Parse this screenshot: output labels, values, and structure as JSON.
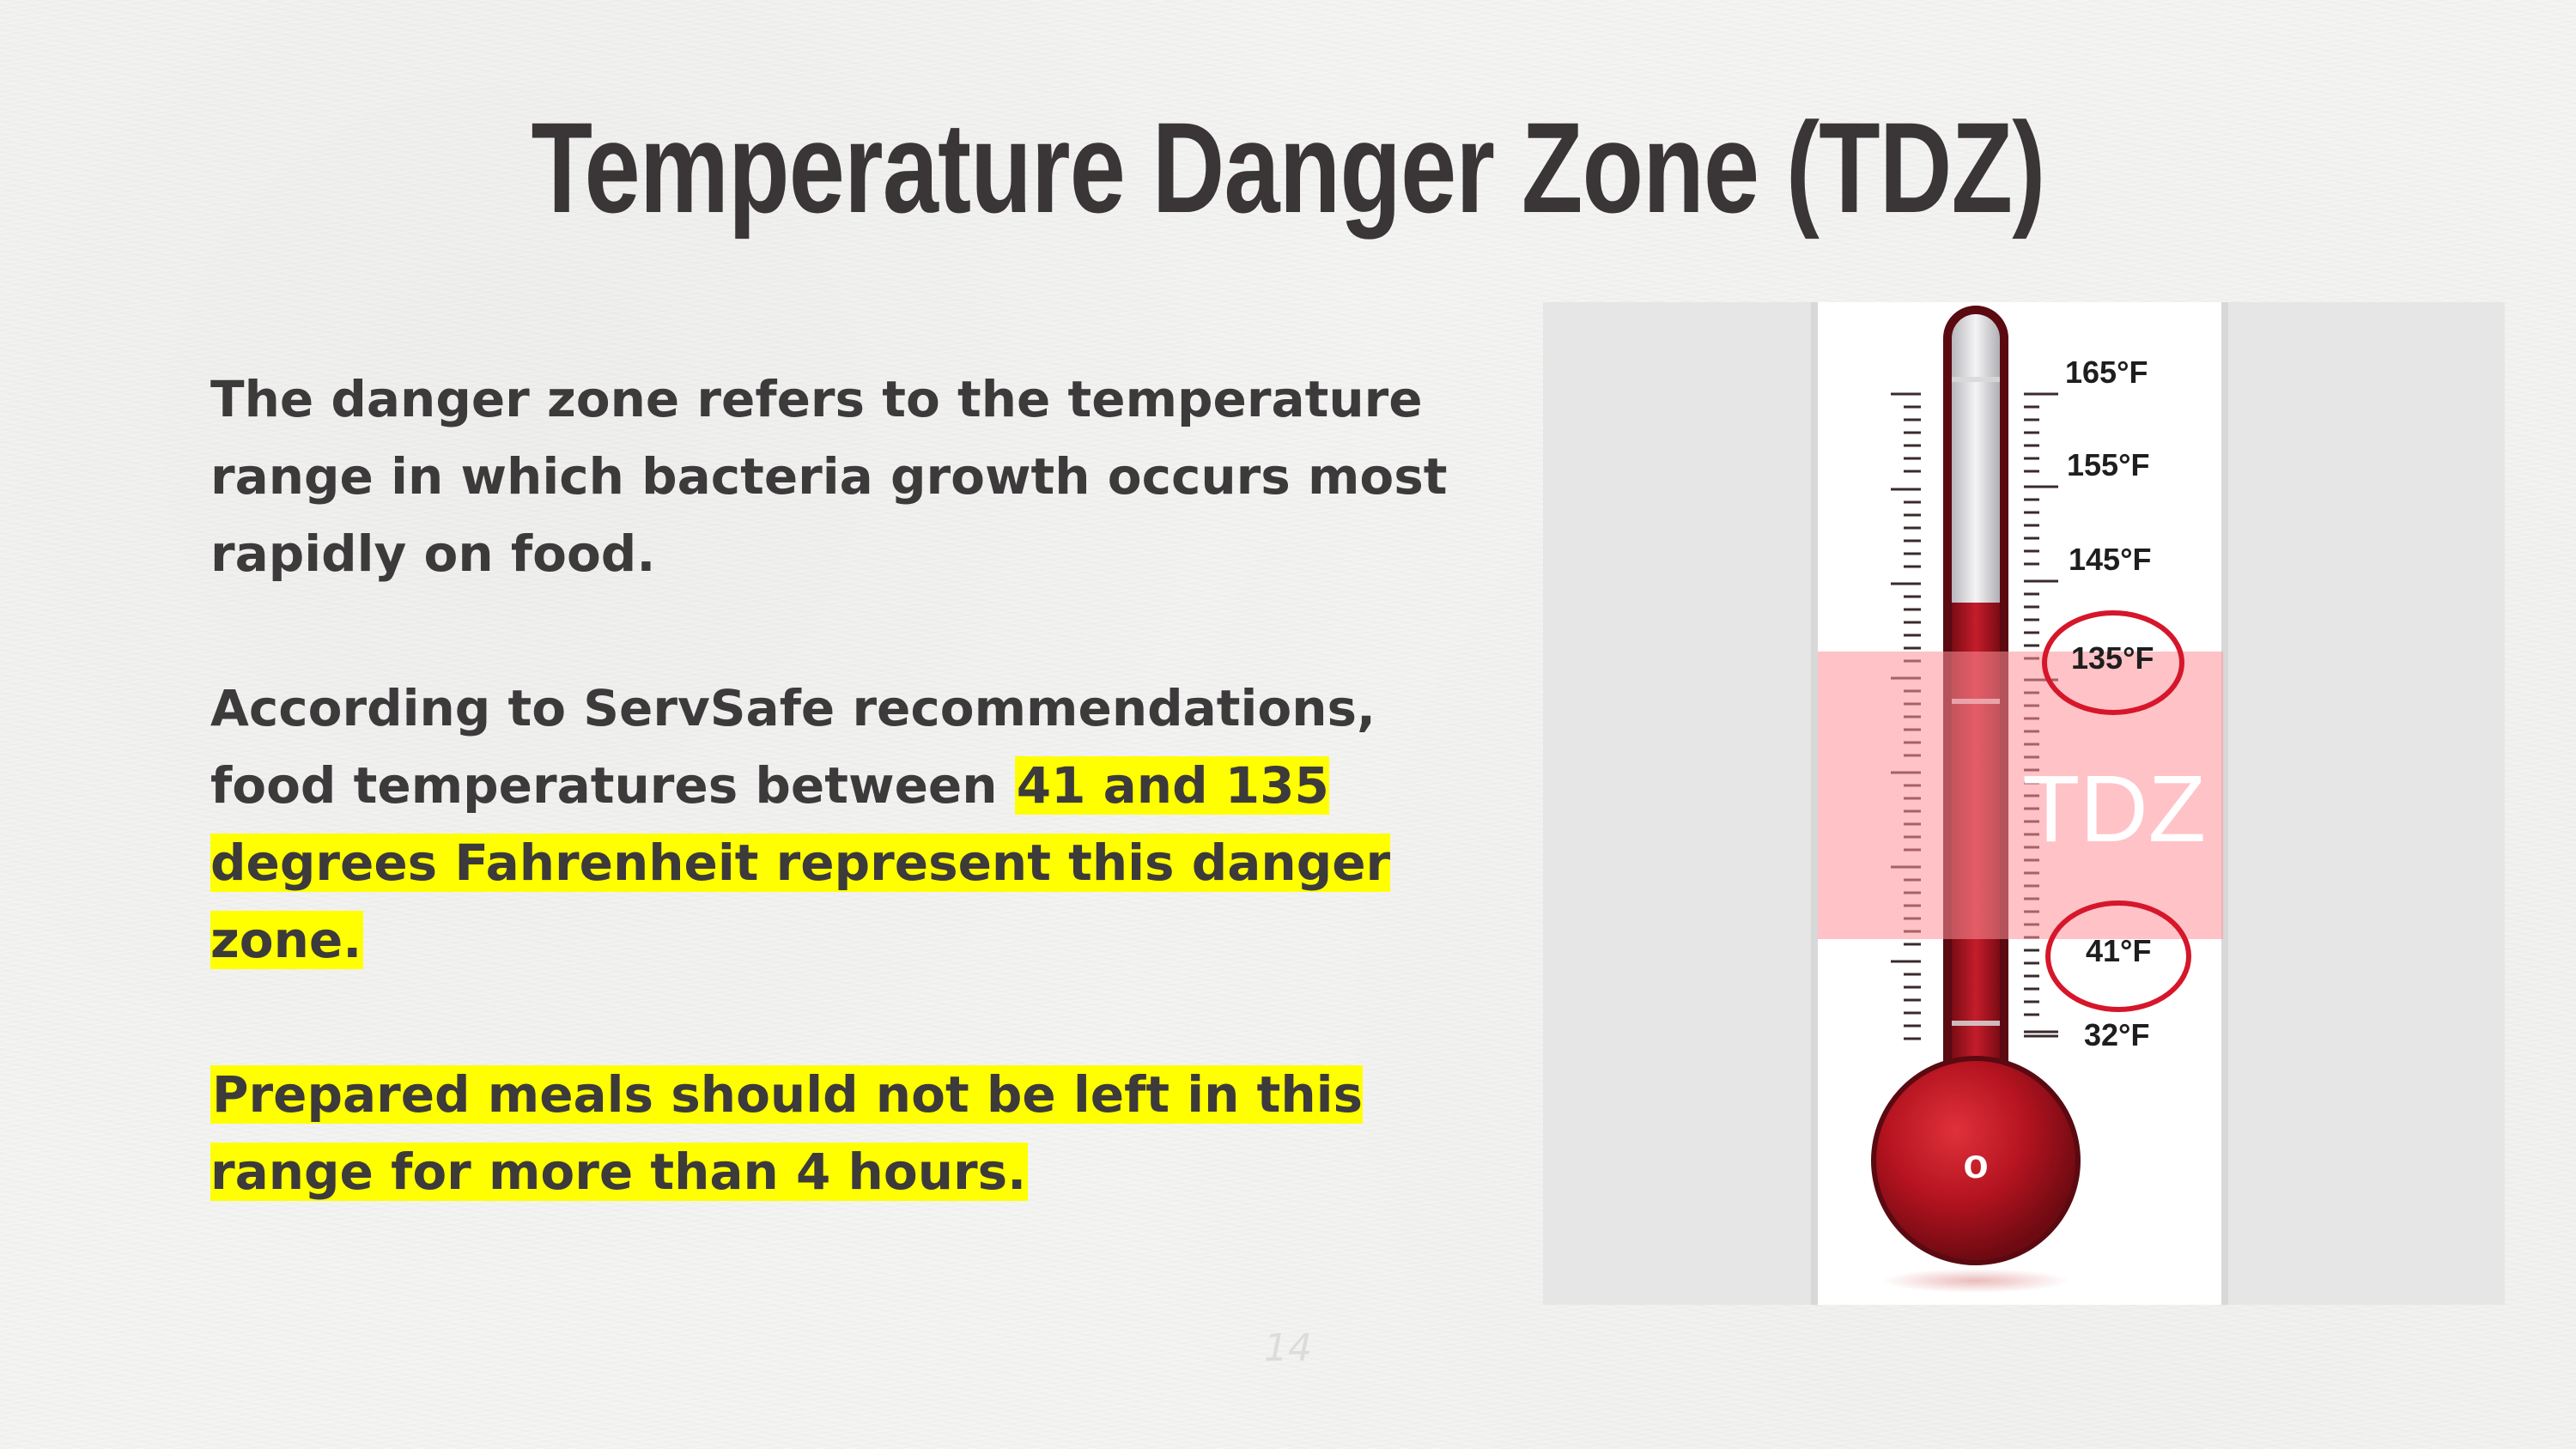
{
  "slide": {
    "title": "Temperature Danger Zone (TDZ)",
    "page_number": "14"
  },
  "body": {
    "para1": "The danger zone refers to the temperature range in which bacteria growth occurs most rapidly on food.",
    "para2_plain": "According to ServSafe recommendations, food temperatures between ",
    "para2_highlight": "41 and 135 degrees Fahrenheit represent this danger zone.",
    "para3_highlight": "Prepared meals should not be left in this range for more than 4 hours."
  },
  "thermometer": {
    "scale_labels": [
      "165°F",
      "155°F",
      "145°F",
      "135°F",
      "41°F",
      "32°F"
    ],
    "zone_label": "TDZ",
    "bulb_mark": "o",
    "circled_labels": [
      "135°F",
      "41°F"
    ]
  },
  "colors": {
    "highlight": "#ffff00",
    "title": "#3a3537",
    "mercury": "#b3131f",
    "zone_band": "#ffb3b8",
    "circle": "#d6162a"
  }
}
